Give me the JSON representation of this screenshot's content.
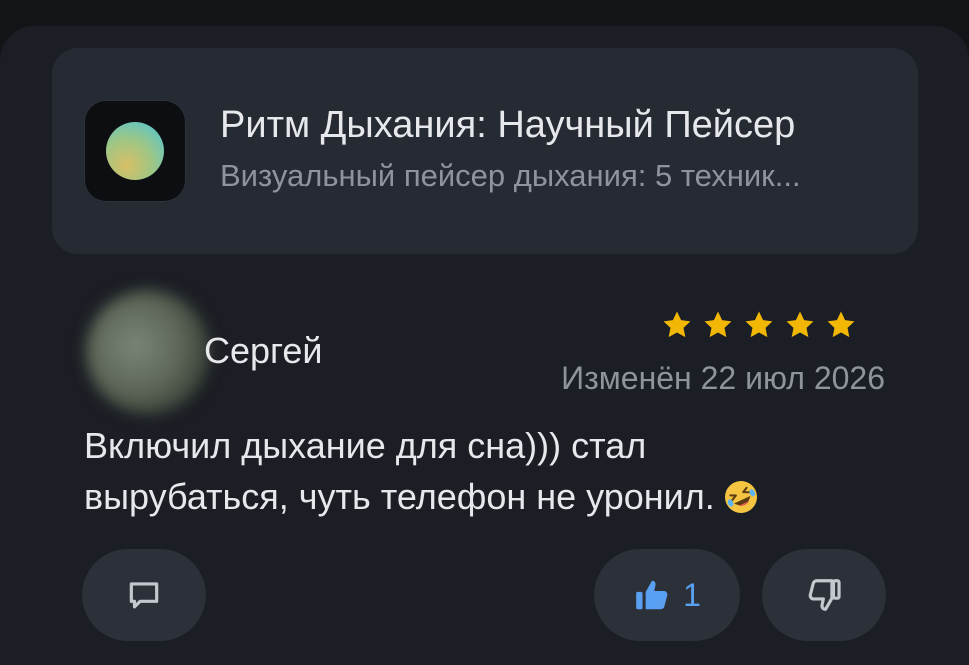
{
  "app": {
    "icon": "breathing-orb-icon",
    "title": "Ритм Дыхания: Научный Пейсер",
    "subtitle": "Визуальный пейсер дыхания: 5 техник..."
  },
  "review": {
    "author": "Сергей",
    "rating": 5,
    "rating_max": 5,
    "star_color": "#f2b705",
    "date": "Изменён 22 июл 2026",
    "text": "Включил дыхание для сна))) стал вырубаться, чуть телефон не уронил.",
    "emoji": "rolling-on-floor-laughing-emoji"
  },
  "actions": {
    "reply_icon": "comment-icon",
    "like_icon": "thumbs-up-icon",
    "like_count": "1",
    "like_color": "#5aa0f2",
    "dislike_icon": "thumbs-down-icon"
  }
}
